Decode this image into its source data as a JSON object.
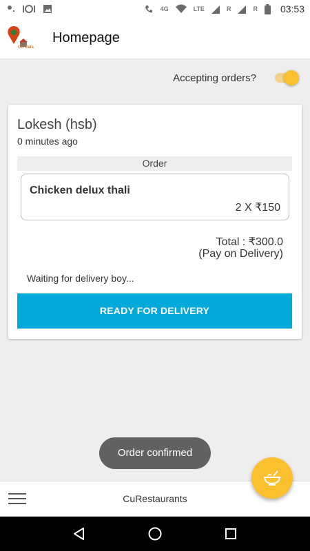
{
  "status_bar": {
    "network_label": "4G",
    "lte_label": "LTE",
    "roaming_label_1": "R",
    "roaming_label_2": "R",
    "time": "03:53"
  },
  "app_bar": {
    "logo_text": "CU Eats",
    "title": "Homepage"
  },
  "accepting": {
    "label": "Accepting orders?",
    "enabled": true,
    "accent_color": "#fbc02d"
  },
  "order": {
    "customer": "Lokesh (hsb)",
    "time_ago": "0 minutes ago",
    "section_label": "Order",
    "items": [
      {
        "name": "Chicken delux thali",
        "qty_price": "2 X ₹150"
      }
    ],
    "total": "Total : ₹300.0",
    "payment": "(Pay on Delivery)",
    "status": "Waiting for delivery boy...",
    "action_label": "READY FOR DELIVERY",
    "action_color": "#03a9d9"
  },
  "toast": {
    "message": "Order confirmed"
  },
  "bottom_bar": {
    "title": "CuRestaurants",
    "menu_icon": "hamburger-icon"
  },
  "fab": {
    "icon": "food-bowl-icon"
  },
  "nav": {
    "back_icon": "back-icon",
    "home_icon": "home-icon",
    "recents_icon": "recents-icon"
  }
}
